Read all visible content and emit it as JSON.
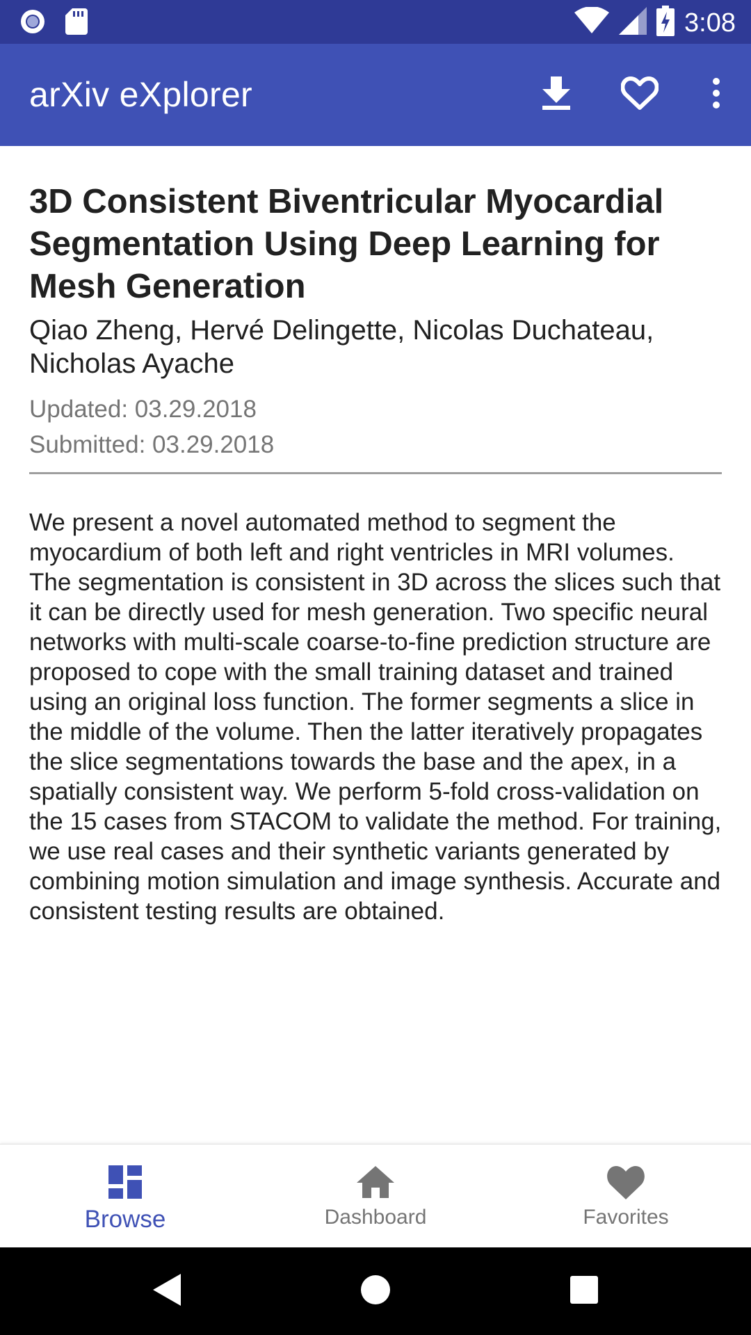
{
  "status_bar": {
    "time": "3:08",
    "icons": [
      "notification-dot-icon",
      "sd-card-icon",
      "wifi-icon",
      "cell-signal-icon",
      "battery-charging-icon"
    ]
  },
  "app_bar": {
    "title": "arXiv eXplorer",
    "actions": [
      "download-icon",
      "favorite-outline-icon",
      "more-vert-icon"
    ]
  },
  "paper": {
    "title": "3D Consistent Biventricular Myocardial Segmentation Using Deep Learning for Mesh Generation",
    "authors": "Qiao Zheng, Hervé Delingette, Nicolas Duchateau, Nicholas Ayache",
    "updated": "Updated: 03.29.2018",
    "submitted": "Submitted: 03.29.2018",
    "abstract": "We present a novel automated method to segment the myocardium of both left and right ventricles in MRI volumes. The segmentation is consistent in 3D across the slices such that it can be directly used for mesh generation. Two specific neural networks with multi-scale coarse-to-fine prediction structure are proposed to cope with the small training dataset and trained using an original loss function. The former segments a slice in the middle of the volume. Then the latter iteratively propagates the slice segmentations towards the base and the apex, in a spatially consistent way. We perform 5-fold cross-validation on the 15 cases from STACOM to validate the method. For training, we use real cases and their synthetic variants generated by combining motion simulation and image synthesis. Accurate and consistent testing results are obtained."
  },
  "bottom_nav": {
    "items": [
      {
        "label": "Browse",
        "icon": "dashboard-grid-icon",
        "active": true
      },
      {
        "label": "Dashboard",
        "icon": "home-icon",
        "active": false
      },
      {
        "label": "Favorites",
        "icon": "heart-icon",
        "active": false
      }
    ]
  },
  "colors": {
    "status_bar": "#2f3a96",
    "primary": "#3f51b5",
    "text_primary": "#212121",
    "text_secondary": "#757575",
    "nav_inactive": "#757575"
  }
}
